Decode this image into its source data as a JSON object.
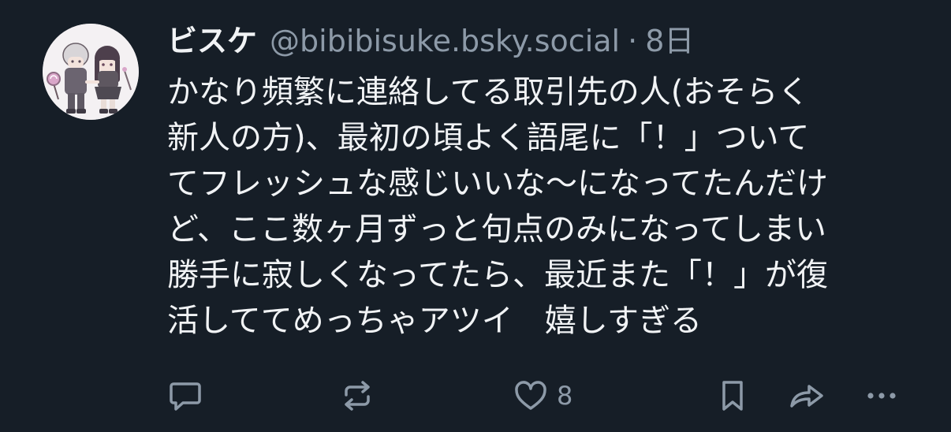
{
  "post": {
    "author": {
      "display_name": "ビスケ",
      "handle": "@bibibisuke.bsky.social"
    },
    "separator": "·",
    "timestamp": "8日",
    "text_lines": [
      "かなり頻繁に連絡してる取引先の人(おそらく",
      "新人の方)、最初の頃よく語尾に「！」ついて",
      "てフレッシュな感じいいな〜になってたんだけ",
      "ど、ここ数ヶ月ずっと句点のみになってしまい",
      "勝手に寂しくなってたら、最近また「！」が復",
      "活しててめっちゃアツイ　嬉しすぎる"
    ],
    "actions": {
      "reply_icon": "speech-bubble-icon",
      "repost_icon": "repost-arrows-icon",
      "like_icon": "heart-outline-icon",
      "like_count": "8",
      "bookmark_icon": "bookmark-icon",
      "share_icon": "share-arrow-icon",
      "more_icon": "ellipsis-icon"
    }
  },
  "colors": {
    "background": "#161e27",
    "text_primary": "#f1f3f5",
    "text_secondary": "#8d9aa8",
    "avatar_background": "#f4f1f3"
  }
}
